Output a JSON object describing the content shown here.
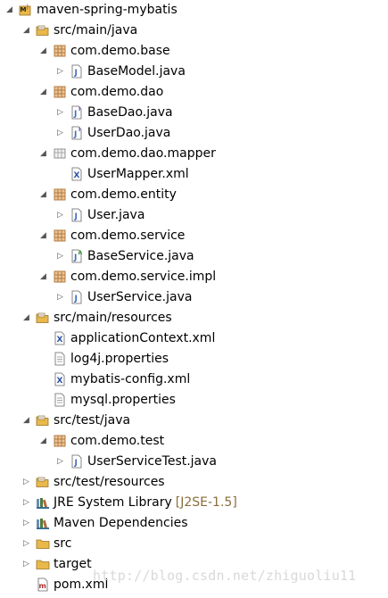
{
  "project": "maven-spring-mybatis",
  "tree": [
    {
      "label": "maven-spring-mybatis",
      "icon": "maven-project-icon",
      "toggle": "expanded",
      "depth": 0
    },
    {
      "label": "src/main/java",
      "icon": "source-folder-icon",
      "toggle": "expanded",
      "depth": 1
    },
    {
      "label": "com.demo.base",
      "icon": "package-icon",
      "toggle": "expanded",
      "depth": 2
    },
    {
      "label": "BaseModel.java",
      "icon": "java-file-icon",
      "toggle": "collapsed",
      "depth": 3
    },
    {
      "label": "com.demo.dao",
      "icon": "package-icon",
      "toggle": "expanded",
      "depth": 2
    },
    {
      "label": "BaseDao.java",
      "icon": "java-interface-icon",
      "toggle": "collapsed",
      "depth": 3
    },
    {
      "label": "UserDao.java",
      "icon": "java-interface-icon",
      "toggle": "collapsed",
      "depth": 3
    },
    {
      "label": "com.demo.dao.mapper",
      "icon": "package-folder-icon",
      "toggle": "expanded",
      "depth": 2
    },
    {
      "label": "UserMapper.xml",
      "icon": "xml-file-icon",
      "toggle": "none",
      "depth": 3
    },
    {
      "label": "com.demo.entity",
      "icon": "package-icon",
      "toggle": "expanded",
      "depth": 2
    },
    {
      "label": "User.java",
      "icon": "java-file-icon",
      "toggle": "collapsed",
      "depth": 3
    },
    {
      "label": "com.demo.service",
      "icon": "package-icon",
      "toggle": "expanded",
      "depth": 2
    },
    {
      "label": "BaseService.java",
      "icon": "java-abstract-icon",
      "toggle": "collapsed",
      "depth": 3
    },
    {
      "label": "com.demo.service.impl",
      "icon": "package-icon",
      "toggle": "expanded",
      "depth": 2
    },
    {
      "label": "UserService.java",
      "icon": "java-file-icon",
      "toggle": "collapsed",
      "depth": 3
    },
    {
      "label": "src/main/resources",
      "icon": "source-folder-icon",
      "toggle": "expanded",
      "depth": 1
    },
    {
      "label": "applicationContext.xml",
      "icon": "xml-file-icon",
      "toggle": "none",
      "depth": 2
    },
    {
      "label": "log4j.properties",
      "icon": "text-file-icon",
      "toggle": "none",
      "depth": 2
    },
    {
      "label": "mybatis-config.xml",
      "icon": "xml-file-icon",
      "toggle": "none",
      "depth": 2
    },
    {
      "label": "mysql.properties",
      "icon": "text-file-icon",
      "toggle": "none",
      "depth": 2
    },
    {
      "label": "src/test/java",
      "icon": "source-folder-icon",
      "toggle": "expanded",
      "depth": 1
    },
    {
      "label": "com.demo.test",
      "icon": "package-icon",
      "toggle": "expanded",
      "depth": 2
    },
    {
      "label": "UserServiceTest.java",
      "icon": "java-file-icon",
      "toggle": "collapsed",
      "depth": 3
    },
    {
      "label": "src/test/resources",
      "icon": "source-folder-icon",
      "toggle": "collapsed",
      "depth": 1
    },
    {
      "label": "JRE System Library",
      "decoration": "[J2SE-1.5]",
      "icon": "library-icon",
      "toggle": "collapsed",
      "depth": 1
    },
    {
      "label": "Maven Dependencies",
      "icon": "library-icon",
      "toggle": "collapsed",
      "depth": 1
    },
    {
      "label": "src",
      "icon": "folder-icon",
      "toggle": "collapsed",
      "depth": 1
    },
    {
      "label": "target",
      "icon": "folder-icon",
      "toggle": "collapsed",
      "depth": 1
    },
    {
      "label": "pom.xml",
      "icon": "maven-pom-icon",
      "toggle": "none",
      "depth": 1
    }
  ],
  "watermark": "http://blog.csdn.net/zhiguoliu11",
  "colors": {
    "folder": "#e8b84a",
    "package": "#b5793f",
    "java": "#3e6ec2",
    "interface": "#6a3fb5",
    "xml": "#2a4fa3",
    "library": "#3b6e8f"
  }
}
